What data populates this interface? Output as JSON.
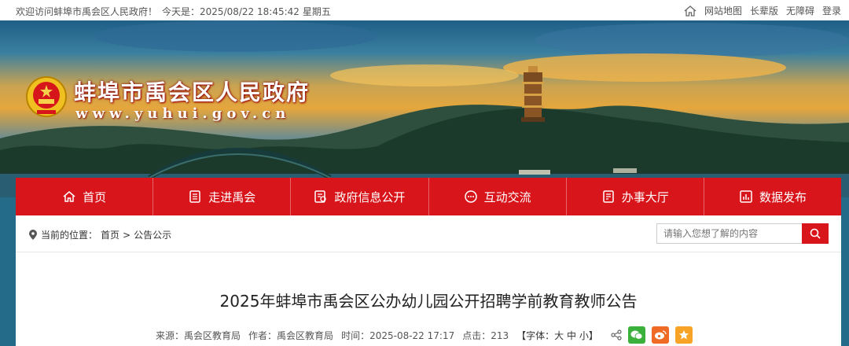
{
  "topbar": {
    "greeting": "欢迎访问蚌埠市禹会区人民政府！",
    "today_label": "今天是：",
    "datetime": "2025/08/22 18:45:42",
    "weekday": "星期五",
    "links": [
      "网站地图",
      "长辈版",
      "无障碍",
      "登录"
    ]
  },
  "site": {
    "title": "蚌埠市禹会区人民政府",
    "url": "www.yuhui.gov.cn"
  },
  "nav": [
    {
      "label": "首页",
      "icon": "home-icon"
    },
    {
      "label": "走进禹会",
      "icon": "list-icon"
    },
    {
      "label": "政府信息公开",
      "icon": "document-icon"
    },
    {
      "label": "互动交流",
      "icon": "chat-icon"
    },
    {
      "label": "办事大厅",
      "icon": "form-icon"
    },
    {
      "label": "数据发布",
      "icon": "chart-icon"
    }
  ],
  "breadcrumb": {
    "prefix": "当前的位置：",
    "home": "首页",
    "separator": ">",
    "current": "公告公示"
  },
  "search": {
    "placeholder": "请输入您想了解的内容"
  },
  "article": {
    "title": "2025年蚌埠市禹会区公办幼儿园公开招聘学前教育教师公告",
    "source_label": "来源：",
    "source": "禹会区教育局",
    "author_label": "作者：",
    "author": "禹会区教育局",
    "time_label": "时间：",
    "time": "2025-08-22 17:17",
    "clicks_label": "点击：",
    "clicks": "213",
    "font_label": "【字体：",
    "font_large": "大",
    "font_medium": "中",
    "font_small": "小",
    "font_close": "】"
  },
  "colors": {
    "nav_red": "#d8151b",
    "wechat_green": "#3bb13c",
    "weibo_orange": "#ef6a24",
    "favorite_orange": "#f7a325"
  }
}
